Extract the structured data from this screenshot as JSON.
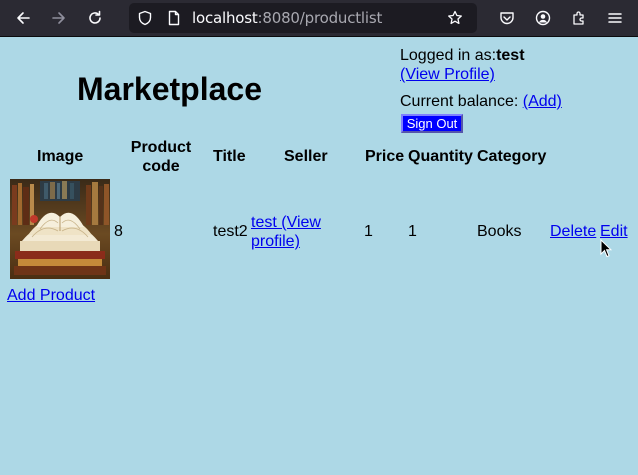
{
  "browser": {
    "url_host": "localhost",
    "url_path": ":8080/productlist"
  },
  "header": {
    "title": "Marketplace",
    "logged_in_label": "Logged in as:",
    "username": "test",
    "view_profile": "(View Profile)",
    "balance_label": "Current balance:",
    "add_balance": "(Add)",
    "sign_out": "Sign Out"
  },
  "table": {
    "headers": {
      "image": "Image",
      "product_code_line1": "Product",
      "product_code_line2": "code",
      "title": "Title",
      "seller": "Seller",
      "price": "Price",
      "quantity": "Quantity",
      "category": "Category"
    },
    "rows": [
      {
        "image_icon": "open-books-image",
        "product_code": "8",
        "title": "test2",
        "seller_line1": "test (View",
        "seller_line2": "profile)",
        "price": "1",
        "quantity": "1",
        "category": "Books",
        "delete": "Delete",
        "edit": "Edit"
      }
    ]
  },
  "footer": {
    "add_product": "Add Product"
  },
  "colors": {
    "page_background": "#add8e6",
    "link": "#0000ee",
    "button_background": "#0000ff"
  }
}
